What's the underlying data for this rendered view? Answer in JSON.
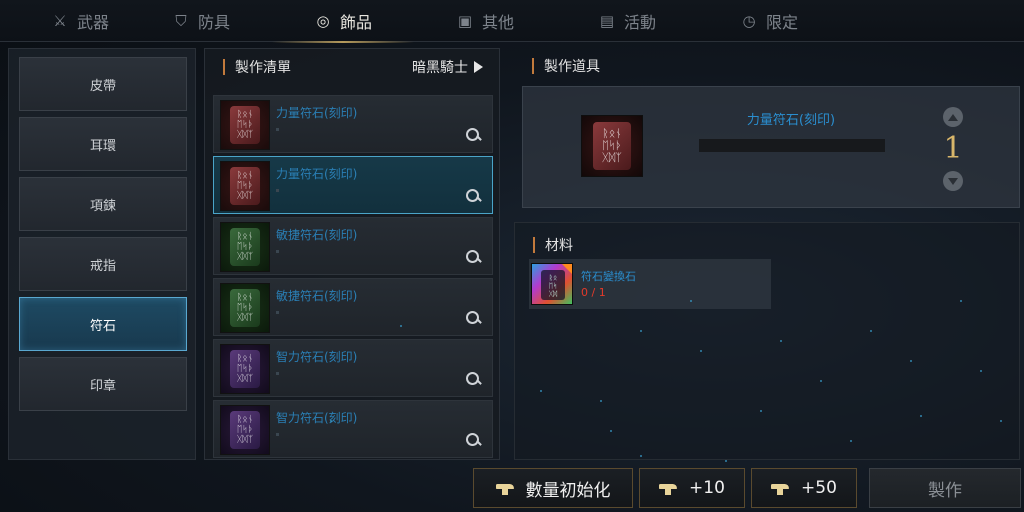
{
  "tabs": [
    {
      "label": "武器",
      "icon": "crossed-swords-icon",
      "glyph": "⚔"
    },
    {
      "label": "防具",
      "icon": "shield-icon",
      "glyph": "⛉"
    },
    {
      "label": "飾品",
      "icon": "necklace-icon",
      "glyph": "◎"
    },
    {
      "label": "其他",
      "icon": "box-icon",
      "glyph": "▣"
    },
    {
      "label": "活動",
      "icon": "gift-icon",
      "glyph": "▤"
    },
    {
      "label": "限定",
      "icon": "stopwatch-icon",
      "glyph": "◷"
    }
  ],
  "active_tab": "飾品",
  "categories": [
    "皮帶",
    "耳環",
    "項鍊",
    "戒指",
    "符石",
    "印章"
  ],
  "active_category": "符石",
  "recipe_list": {
    "title": "製作清單",
    "class_filter": "暗黑騎士",
    "items": [
      {
        "name": "力量符石(刻印)",
        "color": "red",
        "glyph": "ᚱᛟᚾ\nᛖᛋᚦ\nᚷᛞᛉ"
      },
      {
        "name": "力量符石(刻印)",
        "color": "red",
        "glyph": "ᚱᛟᚾ\nᛖᛋᚦ\nᚷᛞᛉ"
      },
      {
        "name": "敏捷符石(刻印)",
        "color": "green",
        "glyph": "ᚱᛟᚾ\nᛖᛋᚦ\nᚷᛞᛉ"
      },
      {
        "name": "敏捷符石(刻印)",
        "color": "green",
        "glyph": "ᚱᛟᚾ\nᛖᛋᚦ\nᚷᛞᛉ"
      },
      {
        "name": "智力符石(刻印)",
        "color": "purple",
        "glyph": "ᚱᛟᚾ\nᛖᛋᚦ\nᚷᛞᛉ"
      },
      {
        "name": "智力符石(刻印)",
        "color": "purple",
        "glyph": "ᚱᛟᚾ\nᛖᛋᚦ\nᚷᛞᛉ"
      }
    ],
    "selected_index": 1
  },
  "tool": {
    "title": "製作道具",
    "name": "力量符石(刻印)",
    "quantity": "1",
    "icon_glyph": "ᚱᛟᚾ\nᛖᛋᚦ\nᚷᛞᛉ"
  },
  "materials": {
    "title": "材料",
    "items": [
      {
        "name": "符石變換石",
        "count": "0 / 1",
        "icon": "transform-stone-icon"
      }
    ]
  },
  "buttons": {
    "reset": "數量初始化",
    "plus10": "+10",
    "plus50": "+50",
    "craft": "製作"
  },
  "colors": {
    "accent_gold": "#d8b66a",
    "accent_blue": "#2a8ecf",
    "warning_red": "#e33a2a"
  }
}
